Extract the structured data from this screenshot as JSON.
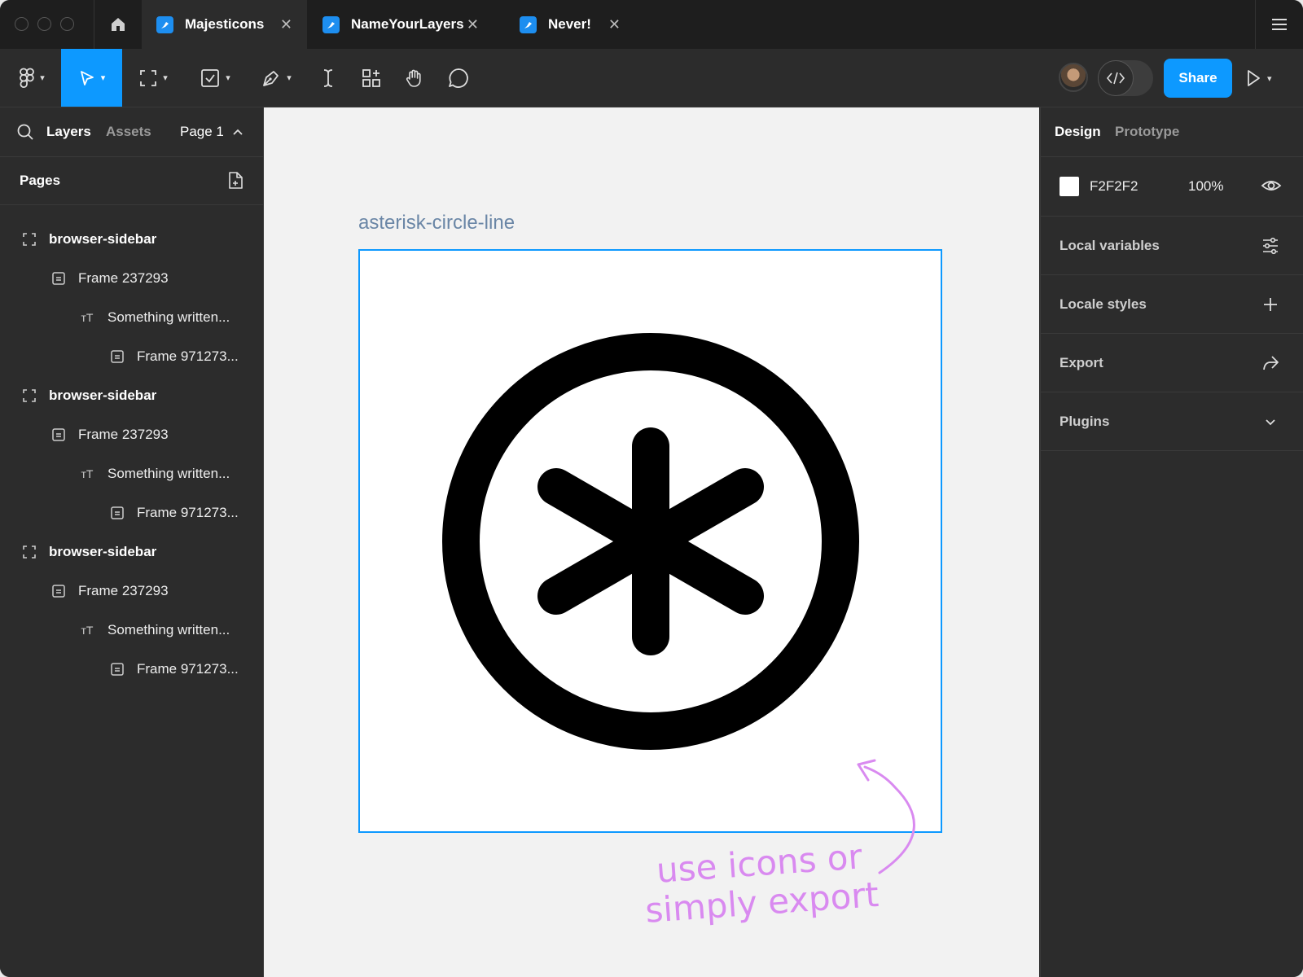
{
  "tabs": [
    {
      "label": "Majesticons",
      "active": true
    },
    {
      "label": "NameYourLayers",
      "active": false
    },
    {
      "label": "Never!",
      "active": false
    }
  ],
  "toolbar": {
    "share_label": "Share",
    "tools": [
      "main-menu",
      "move",
      "frame",
      "shape",
      "pen",
      "text",
      "components",
      "hand",
      "comment"
    ]
  },
  "left_panel": {
    "tab_layers": "Layers",
    "tab_assets": "Assets",
    "page_selector": "Page 1",
    "pages_label": "Pages",
    "layers": [
      {
        "label": "browser-sidebar",
        "level": 0,
        "icon": "frame-icon"
      },
      {
        "label": "Frame 237293",
        "level": 1,
        "icon": "frame-layout-icon"
      },
      {
        "label": "Something written...",
        "level": 2,
        "icon": "text-icon"
      },
      {
        "label": "Frame 971273...",
        "level": 3,
        "icon": "frame-layout-icon"
      },
      {
        "label": "browser-sidebar",
        "level": 0,
        "icon": "frame-icon"
      },
      {
        "label": "Frame 237293",
        "level": 1,
        "icon": "frame-layout-icon"
      },
      {
        "label": "Something written...",
        "level": 2,
        "icon": "text-icon"
      },
      {
        "label": "Frame 971273...",
        "level": 3,
        "icon": "frame-layout-icon"
      },
      {
        "label": "browser-sidebar",
        "level": 0,
        "icon": "frame-icon"
      },
      {
        "label": "Frame 237293",
        "level": 1,
        "icon": "frame-layout-icon"
      },
      {
        "label": "Something written...",
        "level": 2,
        "icon": "text-icon"
      },
      {
        "label": "Frame 971273...",
        "level": 3,
        "icon": "frame-layout-icon"
      }
    ]
  },
  "canvas": {
    "frame_label": "asterisk-circle-line",
    "frame_icon": "asterisk-circle-line-icon",
    "annotation_line1": "use icons or",
    "annotation_line2": "simply export",
    "selection_color": "#0d99ff",
    "annotation_color": "#d98af0"
  },
  "right_panel": {
    "tab_design": "Design",
    "tab_prototype": "Prototype",
    "background_hex": "F2F2F2",
    "background_opacity": "100%",
    "sections": [
      {
        "label": "Local variables",
        "icon": "sliders-icon"
      },
      {
        "label": "Locale styles",
        "icon": "plus-icon"
      },
      {
        "label": "Export",
        "icon": "share-arrow-icon"
      },
      {
        "label": "Plugins",
        "icon": "chevron-down-icon"
      }
    ]
  },
  "colors": {
    "accent": "#0d99ff",
    "panel": "#2c2c2c",
    "canvas": "#F2F2F2"
  }
}
